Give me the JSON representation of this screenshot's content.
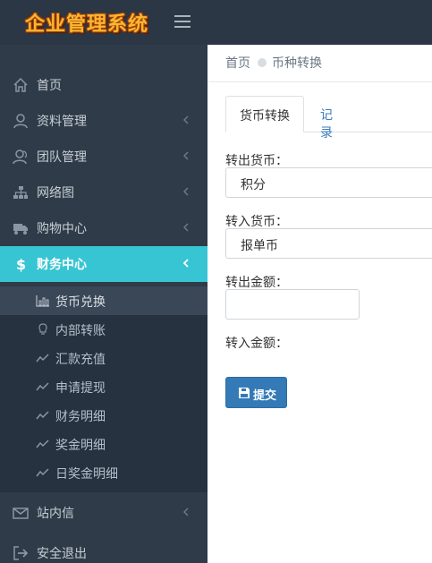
{
  "app": {
    "title": "企业管理系统"
  },
  "sidebar": {
    "items": [
      {
        "label": "首页",
        "icon": "home-icon"
      },
      {
        "label": "资料管理",
        "icon": "user-icon"
      },
      {
        "label": "团队管理",
        "icon": "team-icon"
      },
      {
        "label": "网络图",
        "icon": "sitemap-icon"
      },
      {
        "label": "购物中心",
        "icon": "truck-icon"
      },
      {
        "label": "财务中心",
        "icon": "dollar-icon",
        "active": true
      },
      {
        "label": "站内信",
        "icon": "envelope-icon"
      },
      {
        "label": "安全退出",
        "icon": "sign-out-icon"
      }
    ],
    "submenu": [
      {
        "label": "货币兑换",
        "icon": "bar-chart-icon",
        "active": true
      },
      {
        "label": "内部转账",
        "icon": "lightbulb-icon"
      },
      {
        "label": "汇款充值",
        "icon": "line-chart-icon"
      },
      {
        "label": "申请提现",
        "icon": "line-chart-icon"
      },
      {
        "label": "财务明细",
        "icon": "line-chart-icon"
      },
      {
        "label": "奖金明细",
        "icon": "line-chart-icon"
      },
      {
        "label": "日奖金明细",
        "icon": "line-chart-icon"
      }
    ]
  },
  "breadcrumb": {
    "home": "首页",
    "current": "币种转换"
  },
  "tabs": [
    {
      "label": "货币转换"
    },
    {
      "label": "记录"
    }
  ],
  "form": {
    "from_label": "转出货币：",
    "from_value": "积分",
    "to_label": "转入货币：",
    "to_value": "报单币",
    "amount_out_label": "转出金额：",
    "amount_out_value": "",
    "amount_in_label": "转入金额：",
    "submit_label": "提交"
  },
  "colors": {
    "accent": "#38c5d3",
    "sidebar_bg": "#2f3b48",
    "header_bg": "#2c3745",
    "button": "#337ab7",
    "brand": "#f7b733"
  }
}
